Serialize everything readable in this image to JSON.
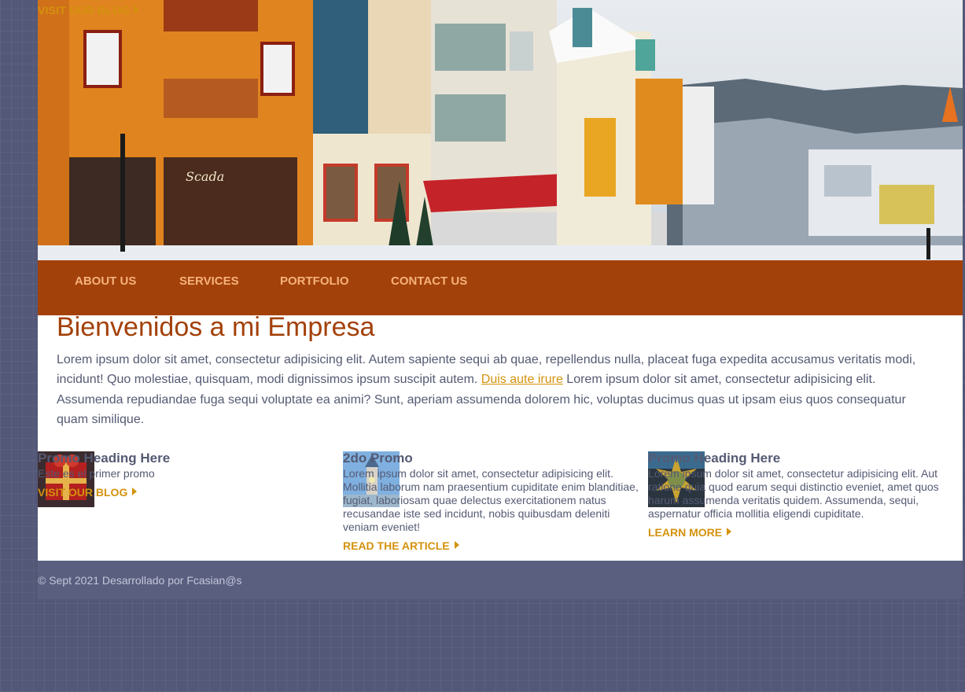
{
  "hero": {
    "image": "winter-village-street-photo",
    "sign_text": "Scada",
    "blog_link": "VISIT OUR BLOG"
  },
  "nav": {
    "items": [
      {
        "label": "ABOUT US"
      },
      {
        "label": "SERVICES"
      },
      {
        "label": "PORTFOLIO"
      },
      {
        "label": "CONTACT US"
      }
    ]
  },
  "main": {
    "title": "Bienvenidos a mi Empresa",
    "lead_part1": "Lorem ipsum dolor sit amet, consectetur adipisicing elit. Autem sapiente sequi ab quae, repellendus nulla, placeat fuga expedita accusamus veritatis modi, incidunt! Quo molestiae, quisquam, modi dignissimos ipsum suscipit autem. ",
    "lead_link": "Duis aute irure",
    "lead_part2": " Lorem ipsum dolor sit amet, consectetur adipisicing elit. Assumenda repudiandae fuga sequi voluptate ea animi? Sunt, aperiam assumenda dolorem hic, voluptas ducimus quas ut ipsam eius quos consequatur quam similique."
  },
  "promos": [
    {
      "heading": "Promo Heading Here",
      "text": "Este es el primer promo",
      "link": "VISIT OUR BLOG",
      "thumb": "gift-box-thumbnail"
    },
    {
      "heading": "2do Promo",
      "text": "Lorem ipsum dolor sit amet, consectetur adipisicing elit. Mollitia laborum nam praesentium cupiditate enim blanditiae, fugiat, laboriosam quae delectus exercitationem natus recusandae iste sed incidunt, nobis quibusdam deleniti veniam eveniet!",
      "link": "READ THE ARTICLE",
      "thumb": "tower-thumbnail"
    },
    {
      "heading": "Promo Heading Here",
      "text": "Lorem ipsum dolor sit amet, consectetur adipisicing elit. Aut ratione quia quod earum sequi distinctio eveniet, amet quos harum assumenda veritatis quidem. Assumenda, sequi, aspernatur officia mollitia eligendi cupiditate.",
      "link": "LEARN MORE",
      "thumb": "sun-medallion-thumbnail"
    }
  ],
  "footer": {
    "text": "© Sept 2021 Desarrollado por Fcasian@s"
  },
  "colors": {
    "accent": "#a3410a",
    "link": "#d4920d",
    "background": "#535878",
    "text": "#555a73"
  }
}
